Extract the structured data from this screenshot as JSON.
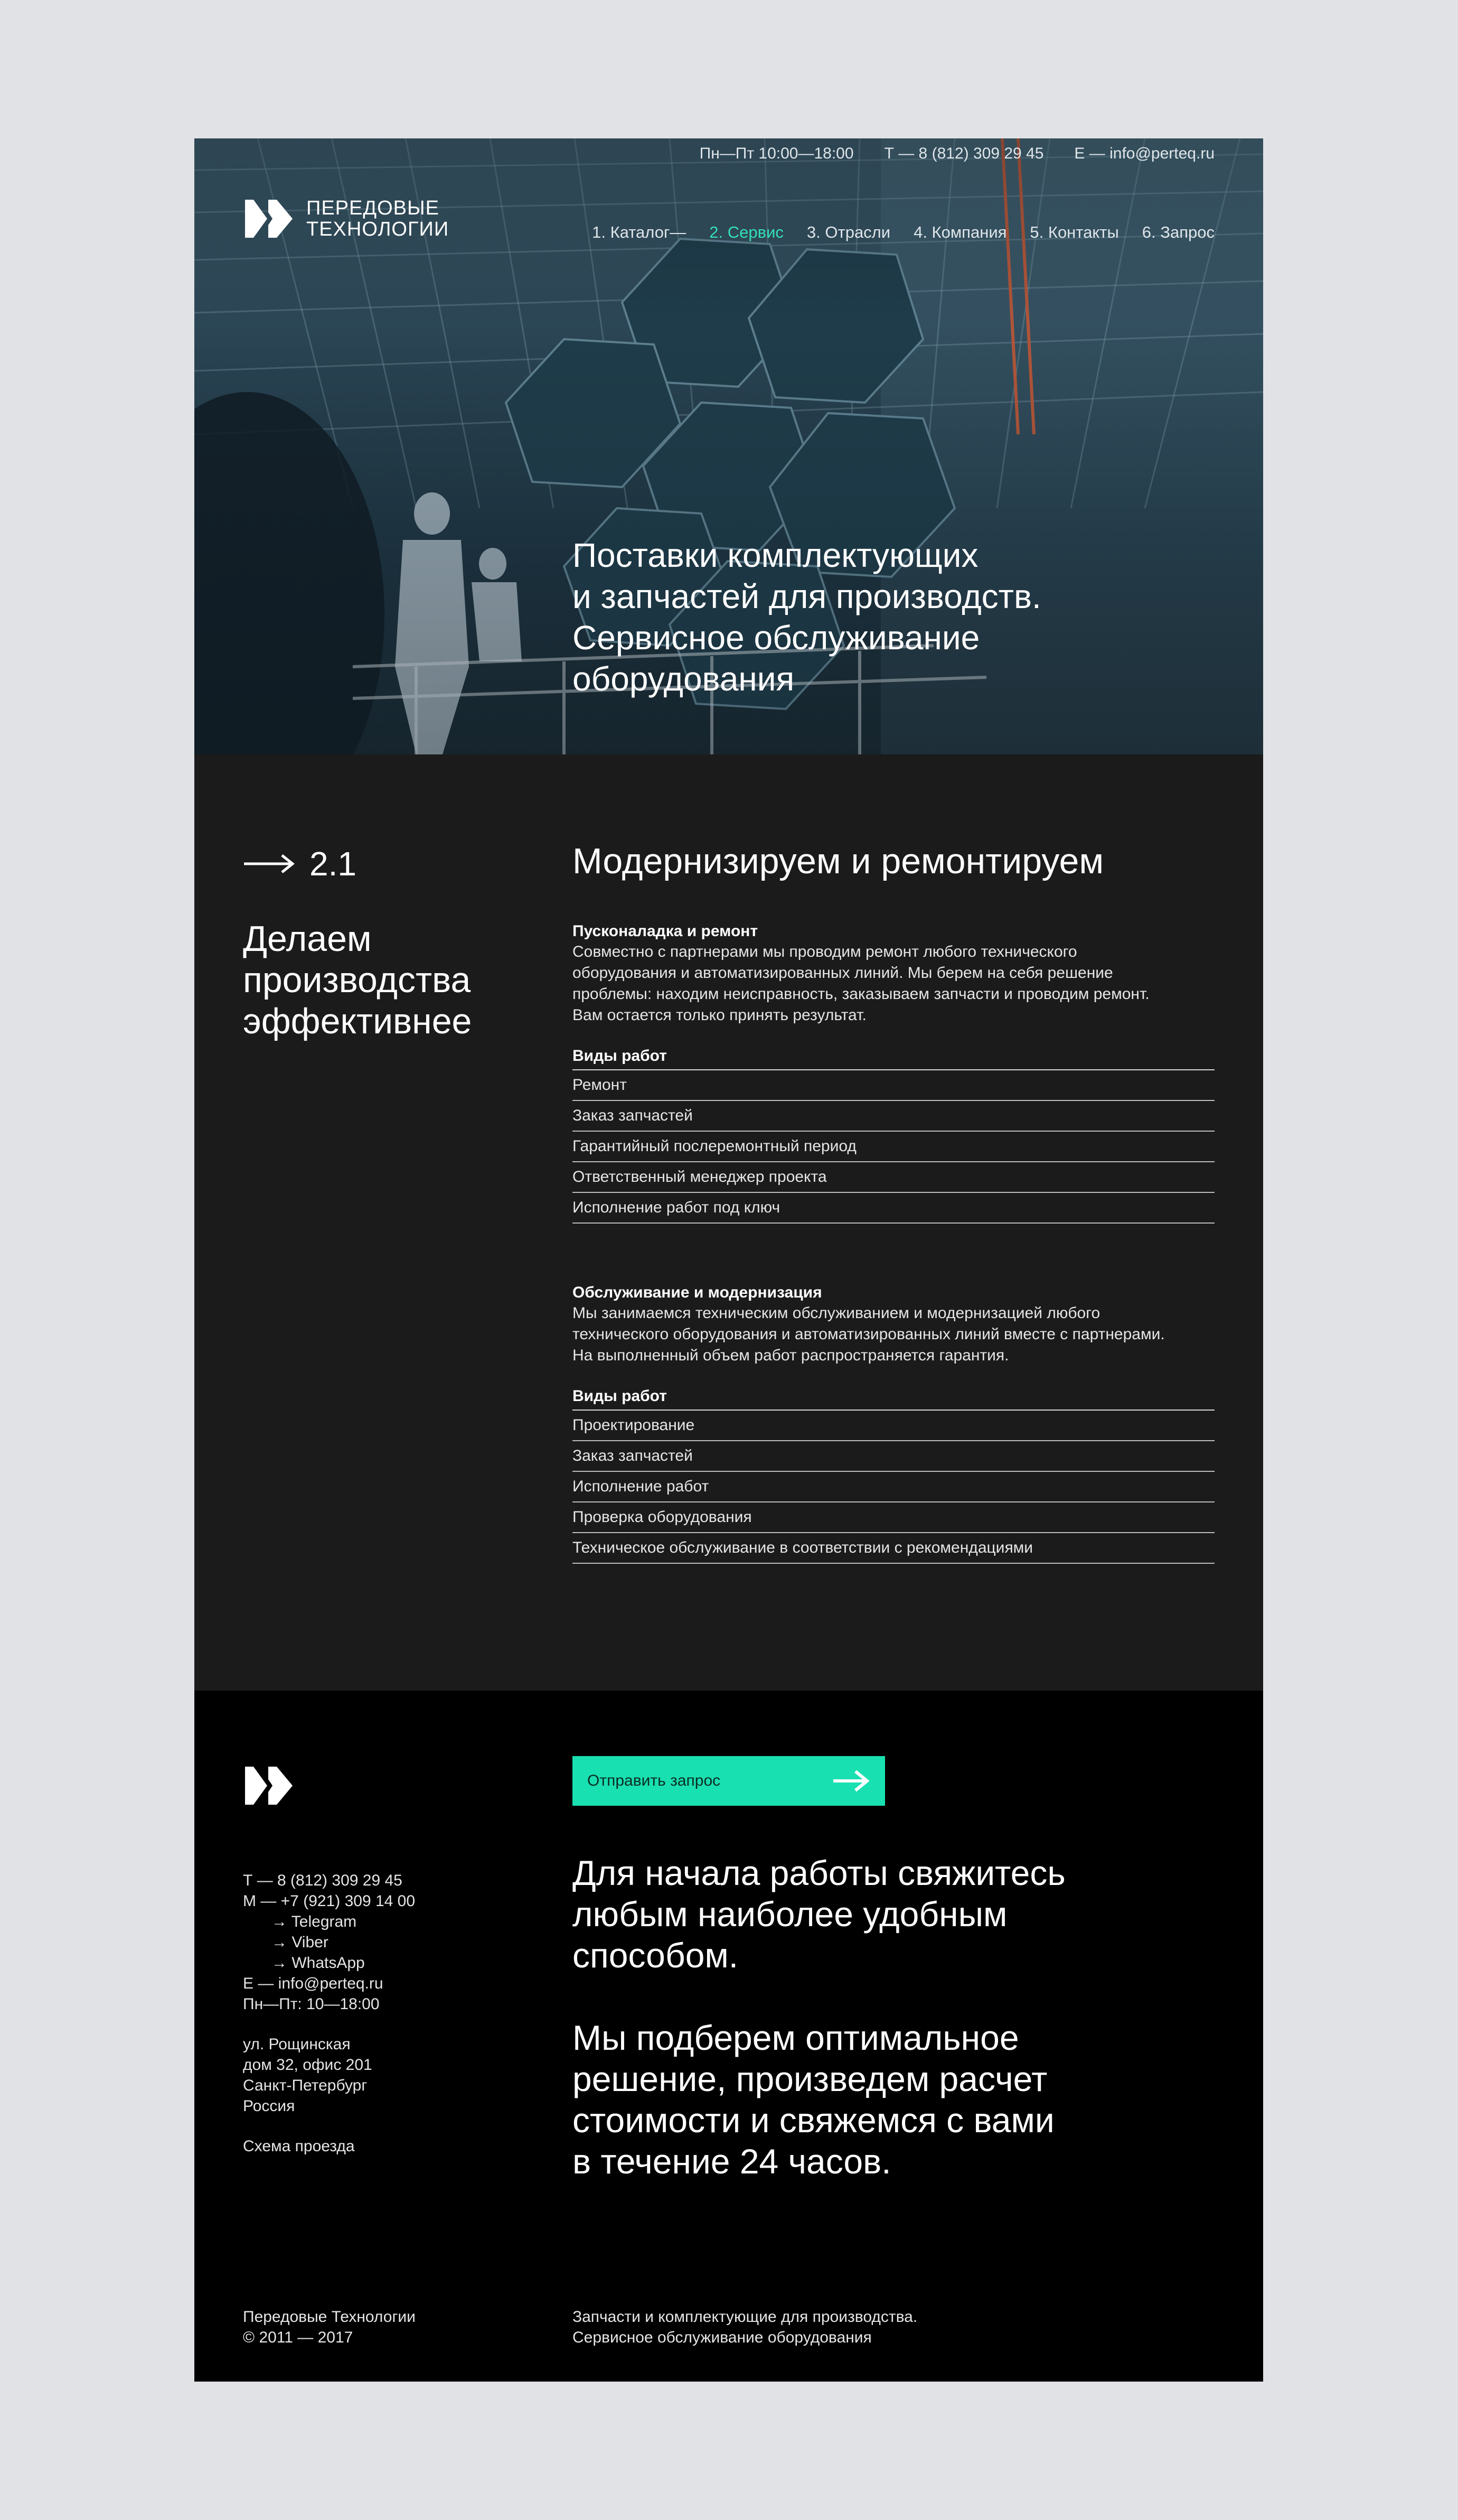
{
  "header": {
    "hours": "Пн—Пт 10:00—18:00",
    "phone": "Т — 8 (812) 309 29 45",
    "email": "Е — info@perteq.ru",
    "logo_line1": "ПЕРЕДОВЫЕ",
    "logo_line2": "ТЕХНОЛОГИИ",
    "nav": [
      {
        "label": "1. Каталог—"
      },
      {
        "label": "2. Сервис"
      },
      {
        "label": "3. Отрасли"
      },
      {
        "label": "4. Компания"
      },
      {
        "label": "5. Контакты"
      },
      {
        "label": "6. Запрос"
      }
    ],
    "active_nav_color": "#34e0b6"
  },
  "hero": {
    "title_lines": [
      "Поставки комплектующих",
      "и запчастей для производств.",
      "Сервисное обслуживание",
      "оборудования"
    ]
  },
  "section": {
    "number": "2.1",
    "title_lines": [
      "Делаем",
      "производства",
      "эффективнее"
    ],
    "heading": "Модернизируем и ремонтируем",
    "blocks": [
      {
        "heading": "Пусконаладка и ремонт",
        "text_lines": [
          "Совместно с партнерами мы проводим ремонт любого технического",
          "оборудования и автоматизированных линий. Мы берем на себя решение",
          "проблемы: находим неисправность, заказываем запчасти и проводим ремонт.",
          "Вам остается только принять результат."
        ],
        "kinds_label": "Виды работ",
        "items": [
          "Ремонт",
          "Заказ запчастей",
          "Гарантийный послеремонтный период",
          "Ответственный менеджер проекта",
          "Исполнение работ под ключ"
        ]
      },
      {
        "heading": "Обслуживание и модернизация",
        "text_lines": [
          "Мы занимаемся техническим обслуживанием и модернизацией любого",
          "технического оборудования и автоматизированных линий вместе с партнерами.",
          "На выполненный объем работ распространяется гарантия."
        ],
        "kinds_label": "Виды работ",
        "items": [
          "Проектирование",
          "Заказ запчастей",
          "Исполнение работ",
          "Проверка оборудования",
          "Техническое обслуживание в соответствии с рекомендациями"
        ]
      }
    ]
  },
  "footer": {
    "contacts": [
      {
        "text": "Т — 8 (812) 309 29 45",
        "indent": false
      },
      {
        "text": "М — +7 (921) 309 14 00",
        "indent": false
      },
      {
        "text": "→ Telegram",
        "indent": true
      },
      {
        "text": "→ Viber",
        "indent": true
      },
      {
        "text": "→ WhatsApp",
        "indent": true
      },
      {
        "text": "Е — info@perteq.ru",
        "indent": false
      },
      {
        "text": "Пн—Пт: 10—18:00",
        "indent": false
      }
    ],
    "address_lines": [
      "ул. Рощинская",
      "дом 32, офис 201",
      "Санкт-Петербург",
      "Россия"
    ],
    "route_link": "Схема проезда",
    "button_label": "Отправить запрос",
    "button_color": "#19e0b0",
    "cta_paragraphs": [
      [
        "Для начала работы свяжитесь",
        "любым наиболее удобным",
        "способом."
      ],
      [
        "Мы подберем оптимальное",
        "решение, произведем расчет",
        "стоимости и свяжемся с вами",
        "в течение 24 часов."
      ]
    ],
    "company": "Передовые Технологии",
    "copyright": "© 2011 — 2017",
    "tagline_lines": [
      "Запчасти и комплектующие для производства.",
      "Сервисное обслуживание оборудования"
    ]
  }
}
